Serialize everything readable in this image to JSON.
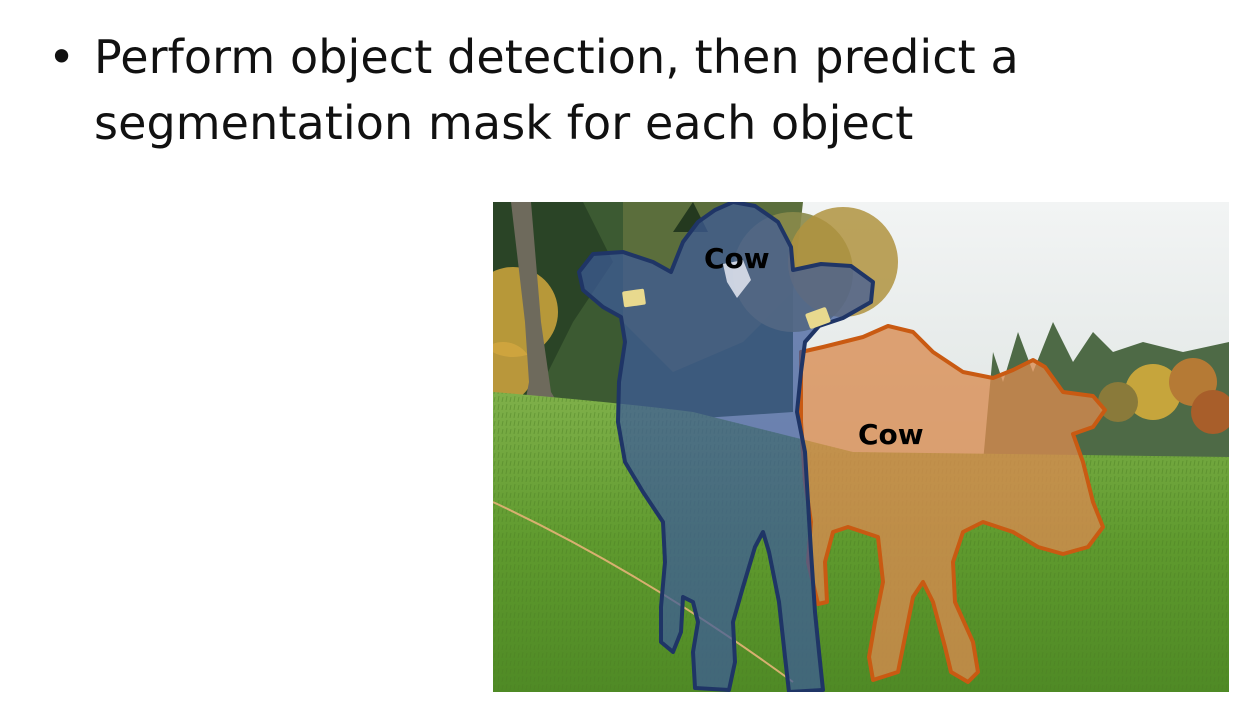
{
  "slide": {
    "bullet_symbol": "•",
    "bullet_lines": [
      "Perform object detection, then predict a",
      "segmentation mask for each object"
    ]
  },
  "figure": {
    "masks": [
      {
        "label": "Cow",
        "fill": "#3d5a9a",
        "outline": "#1f3566"
      },
      {
        "label": "Cow",
        "fill": "#d98a4f",
        "outline": "#c95a12"
      }
    ]
  },
  "colors": {
    "text": "#111111",
    "sky": "#e9ecec",
    "grass": "#5f9a2e",
    "tree_dark": "#2f4a2a",
    "foliage_autumn": "#c89a3a"
  }
}
